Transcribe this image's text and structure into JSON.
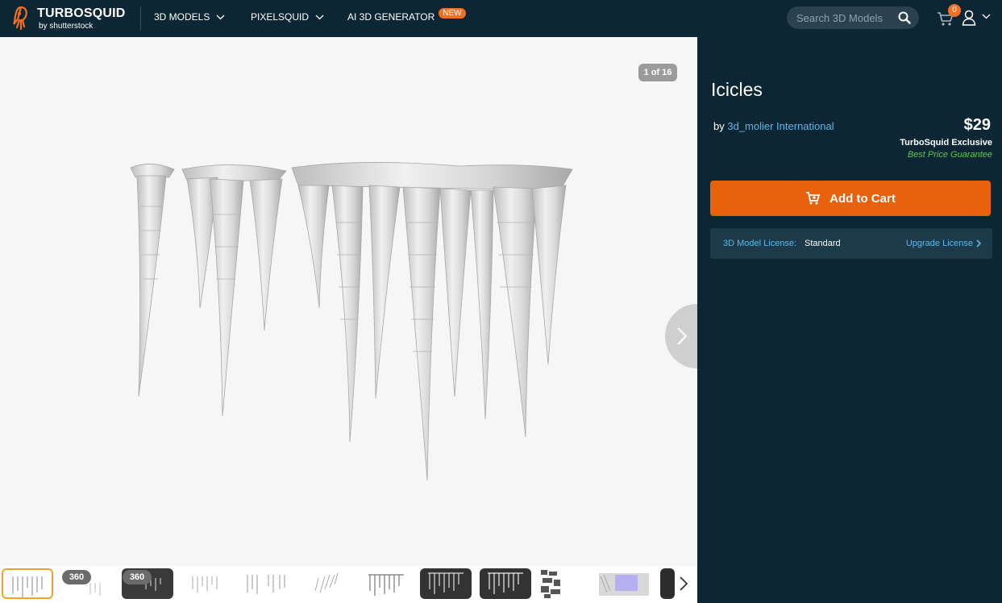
{
  "header": {
    "brand": "TURBOSQUID",
    "brand_sub": "by shutterstock",
    "nav": {
      "models": "3D MODELS",
      "pixelsquid": "PIXELSQUID",
      "ai": "AI 3D GENERATOR",
      "ai_badge": "NEW"
    },
    "search_placeholder": "Search 3D Models",
    "cart_count": "0"
  },
  "viewer": {
    "counter": "1 of 16",
    "thumbs": [
      {
        "label": ""
      },
      {
        "label": "360"
      },
      {
        "label": "360"
      }
    ]
  },
  "product": {
    "title": "Icicles",
    "by_prefix": "by",
    "author": "3d_molier International",
    "price": "$29",
    "exclusive": "TurboSquid Exclusive",
    "guarantee": "Best Price Guarantee",
    "add_to_cart": "Add to Cart",
    "license_label": "3D Model License:",
    "license_value": "Standard",
    "upgrade": "Upgrade License"
  },
  "colors": {
    "nav_bg": "#0c2634",
    "accent_orange": "#e8610d",
    "link_blue": "#5fb7e8",
    "guarantee_green": "#5ec84e"
  }
}
